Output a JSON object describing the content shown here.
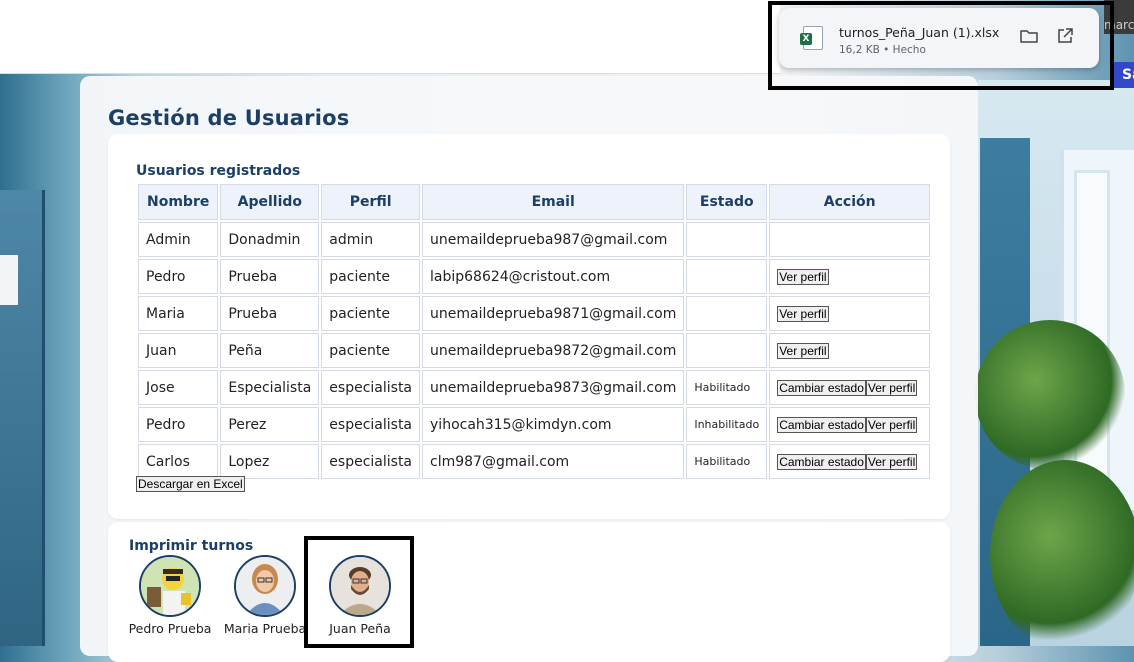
{
  "topbar": {
    "right_text": "marca",
    "side_button": "Sa"
  },
  "download": {
    "filename": "turnos_Peña_Juan (1).xlsx",
    "meta": "16,2 KB • Hecho",
    "icons": {
      "file": "excel-file-icon",
      "folder": "folder-icon",
      "open": "open-external-icon"
    }
  },
  "page": {
    "title": "Gestión de Usuarios"
  },
  "users": {
    "section_title": "Usuarios registrados",
    "columns": [
      "Nombre",
      "Apellido",
      "Perfil",
      "Email",
      "Estado",
      "Acción"
    ],
    "rows": [
      {
        "nombre": "Admin",
        "apellido": "Donadmin",
        "perfil": "admin",
        "email": "unemaildeprueba987@gmail.com",
        "estado": "",
        "acciones": []
      },
      {
        "nombre": "Pedro",
        "apellido": "Prueba",
        "perfil": "paciente",
        "email": "labip68624@cristout.com",
        "estado": "",
        "acciones": [
          "Ver perfil"
        ]
      },
      {
        "nombre": "Maria",
        "apellido": "Prueba",
        "perfil": "paciente",
        "email": "unemaildeprueba9871@gmail.com",
        "estado": "",
        "acciones": [
          "Ver perfil"
        ]
      },
      {
        "nombre": "Juan",
        "apellido": "Peña",
        "perfil": "paciente",
        "email": "unemaildeprueba9872@gmail.com",
        "estado": "",
        "acciones": [
          "Ver perfil"
        ]
      },
      {
        "nombre": "Jose",
        "apellido": "Especialista",
        "perfil": "especialista",
        "email": "unemaildeprueba9873@gmail.com",
        "estado": "Habilitado",
        "acciones": [
          "Cambiar estado",
          "Ver perfil"
        ]
      },
      {
        "nombre": "Pedro",
        "apellido": "Perez",
        "perfil": "especialista",
        "email": "yihocah315@kimdyn.com",
        "estado": "Inhabilitado",
        "acciones": [
          "Cambiar estado",
          "Ver perfil"
        ]
      },
      {
        "nombre": "Carlos",
        "apellido": "Lopez",
        "perfil": "especialista",
        "email": "clm987@gmail.com",
        "estado": "Habilitado",
        "acciones": [
          "Cambiar estado",
          "Ver perfil"
        ]
      }
    ],
    "excel_button": "Descargar en Excel"
  },
  "print": {
    "section_title": "Imprimir turnos",
    "patients": [
      {
        "name": "Pedro Prueba",
        "selected": false
      },
      {
        "name": "Maria Prueba",
        "selected": false
      },
      {
        "name": "Juan Peña",
        "selected": true
      }
    ]
  },
  "colors": {
    "title": "#1c3f66",
    "header_bg": "#eef3fb",
    "excel_green": "#1e7145",
    "accent_blue": "#3347c9"
  }
}
